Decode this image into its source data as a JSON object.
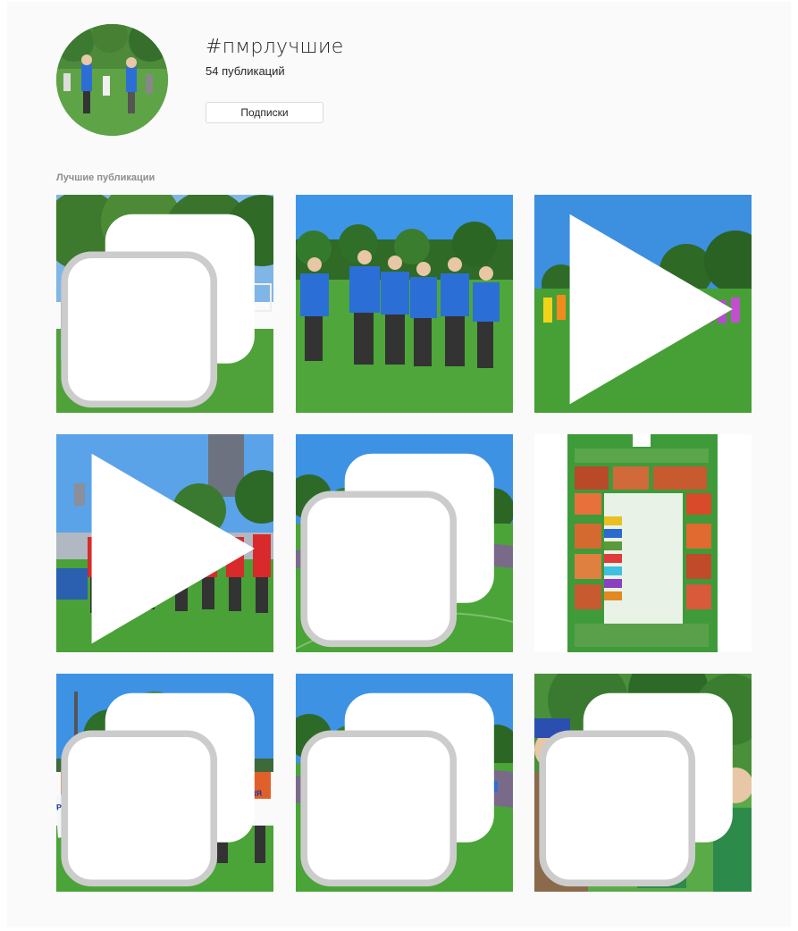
{
  "hashtag": {
    "title": "#пмрлучшие",
    "posts_count": "54 публикаций",
    "follow_button": "Подписки"
  },
  "section": {
    "top_posts_label": "Лучшие публикации"
  },
  "posts": [
    {
      "badge": "carousel-icon"
    },
    {
      "badge": ""
    },
    {
      "badge": "video-icon"
    },
    {
      "badge": "video-icon"
    },
    {
      "badge": "carousel-icon"
    },
    {
      "badge": ""
    },
    {
      "badge": "carousel-icon"
    },
    {
      "badge": "carousel-icon"
    },
    {
      "badge": "carousel-icon"
    }
  ],
  "banner_text": "ТЕРРИТОРИАЛЬНАЯ ПРОФСОЮЗНАЯ ОРГАНИЗАЦИЯ МУНИЦИПАЛЬНЫХ РАБОТНИКОВ СВАО г. МОСКВЫ",
  "colors": {
    "sky": "#3a8fe0",
    "grass": "#3f9a2f",
    "trees": "#2e6b2a",
    "vest_blue": "#2b6fd6",
    "accent_border": "#dbdbdb"
  }
}
